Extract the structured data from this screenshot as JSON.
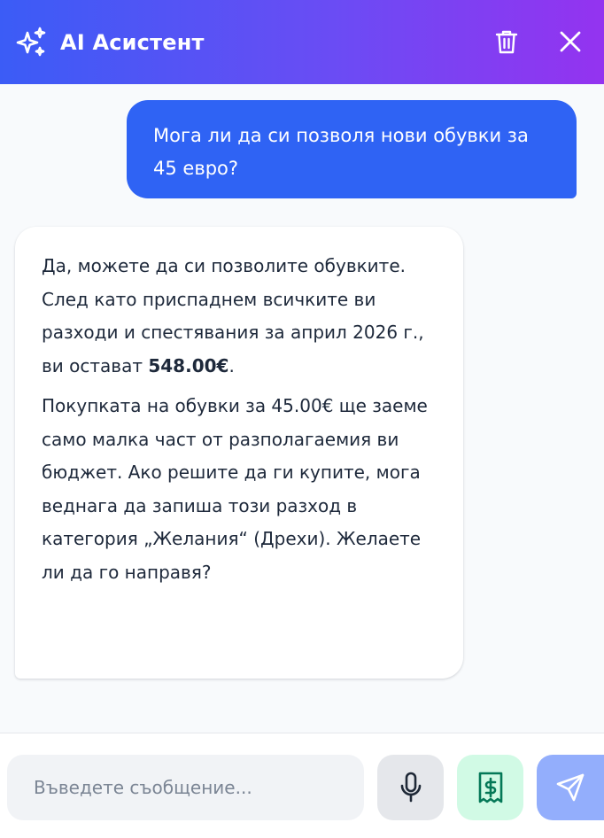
{
  "header": {
    "title": "AI Асистент",
    "icons": {
      "logo": "sparkles-icon",
      "delete": "trash-icon",
      "close": "close-icon"
    }
  },
  "messages": [
    {
      "role": "user",
      "text": "Мога ли да си позволя нови обувки за 45 евро?"
    },
    {
      "role": "assistant",
      "para1_before": "Да, можете да си позволите обувките. След като приспаднем всичките ви разходи и спестявания за април 2026 г., ви остават ",
      "para1_amount": "548.00€",
      "para1_after": ".",
      "para2": "Покупката на обувки за 45.00€ ще заеме само малка част от разполагаемия ви бюджет. Ако решите да ги купите, мога веднага да запиша този разход в категория „Желания“ (Дрехи). Желаете ли да го направя?"
    }
  ],
  "composer": {
    "placeholder": "Въведете съобщение...",
    "value": "",
    "icons": {
      "voice": "microphone-icon",
      "expense": "receipt-dollar-icon",
      "send": "send-icon"
    }
  },
  "colors": {
    "header_gradient_start": "#3b5cf6",
    "header_gradient_end": "#9433f0",
    "user_bubble": "#2f63f4",
    "expense_button": "#d1fae5",
    "expense_icon": "#047857",
    "send_button": "#93aefc"
  }
}
